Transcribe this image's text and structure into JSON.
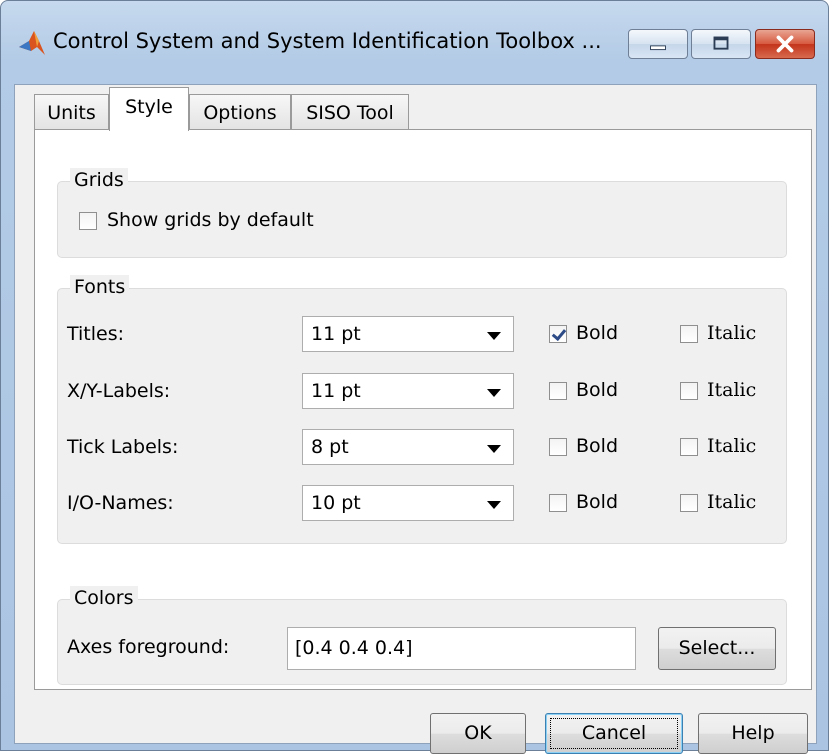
{
  "window": {
    "title": "Control System and System Identification Toolbox ...",
    "accent_color": "#b3cbe6"
  },
  "tabs": [
    {
      "label": "Units",
      "active": false
    },
    {
      "label": "Style",
      "active": true
    },
    {
      "label": "Options",
      "active": false
    },
    {
      "label": "SISO Tool",
      "active": false
    }
  ],
  "grids": {
    "label": "Grids",
    "show_grids_label": "Show grids by default",
    "show_grids_checked": false
  },
  "fonts": {
    "label": "Fonts",
    "rows": [
      {
        "label": "Titles:",
        "size": "11 pt",
        "bold_label": "Bold",
        "bold": true,
        "italic_label": "Italic",
        "italic": false
      },
      {
        "label": "X/Y-Labels:",
        "size": "11 pt",
        "bold_label": "Bold",
        "bold": false,
        "italic_label": "Italic",
        "italic": false
      },
      {
        "label": "Tick Labels:",
        "size": "8 pt",
        "bold_label": "Bold",
        "bold": false,
        "italic_label": "Italic",
        "italic": false
      },
      {
        "label": "I/O-Names:",
        "size": "10 pt",
        "bold_label": "Bold",
        "bold": false,
        "italic_label": "Italic",
        "italic": false
      }
    ]
  },
  "colors": {
    "label": "Colors",
    "axes_label": "Axes foreground:",
    "axes_value": "[0.4 0.4 0.4]",
    "select_label": "Select..."
  },
  "buttons": {
    "ok": "OK",
    "cancel": "Cancel",
    "help": "Help"
  }
}
